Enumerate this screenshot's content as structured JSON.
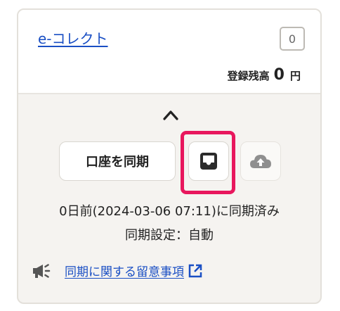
{
  "card": {
    "service_name": "e-コレクト",
    "count_badge": "0",
    "balance": {
      "label": "登録残高",
      "value": "0",
      "unit": "円"
    },
    "collapse_icon": "chevron-up-icon",
    "actions": {
      "sync_label": "口座を同期",
      "inbox_icon": "inbox-icon",
      "upload_icon": "cloud-upload-icon",
      "highlight_color": "#e8175d"
    },
    "sync_status": "0日前(2024-03-06 07:11)に同期済み",
    "sync_setting": "同期設定：自動",
    "notice": {
      "icon": "megaphone-icon",
      "link_text": "同期に関する留意事項",
      "link_icon": "external-link-icon"
    }
  },
  "colors": {
    "link": "#1a4fc4",
    "card_bottom_bg": "#f5f3f0",
    "highlight": "#e8175d"
  }
}
